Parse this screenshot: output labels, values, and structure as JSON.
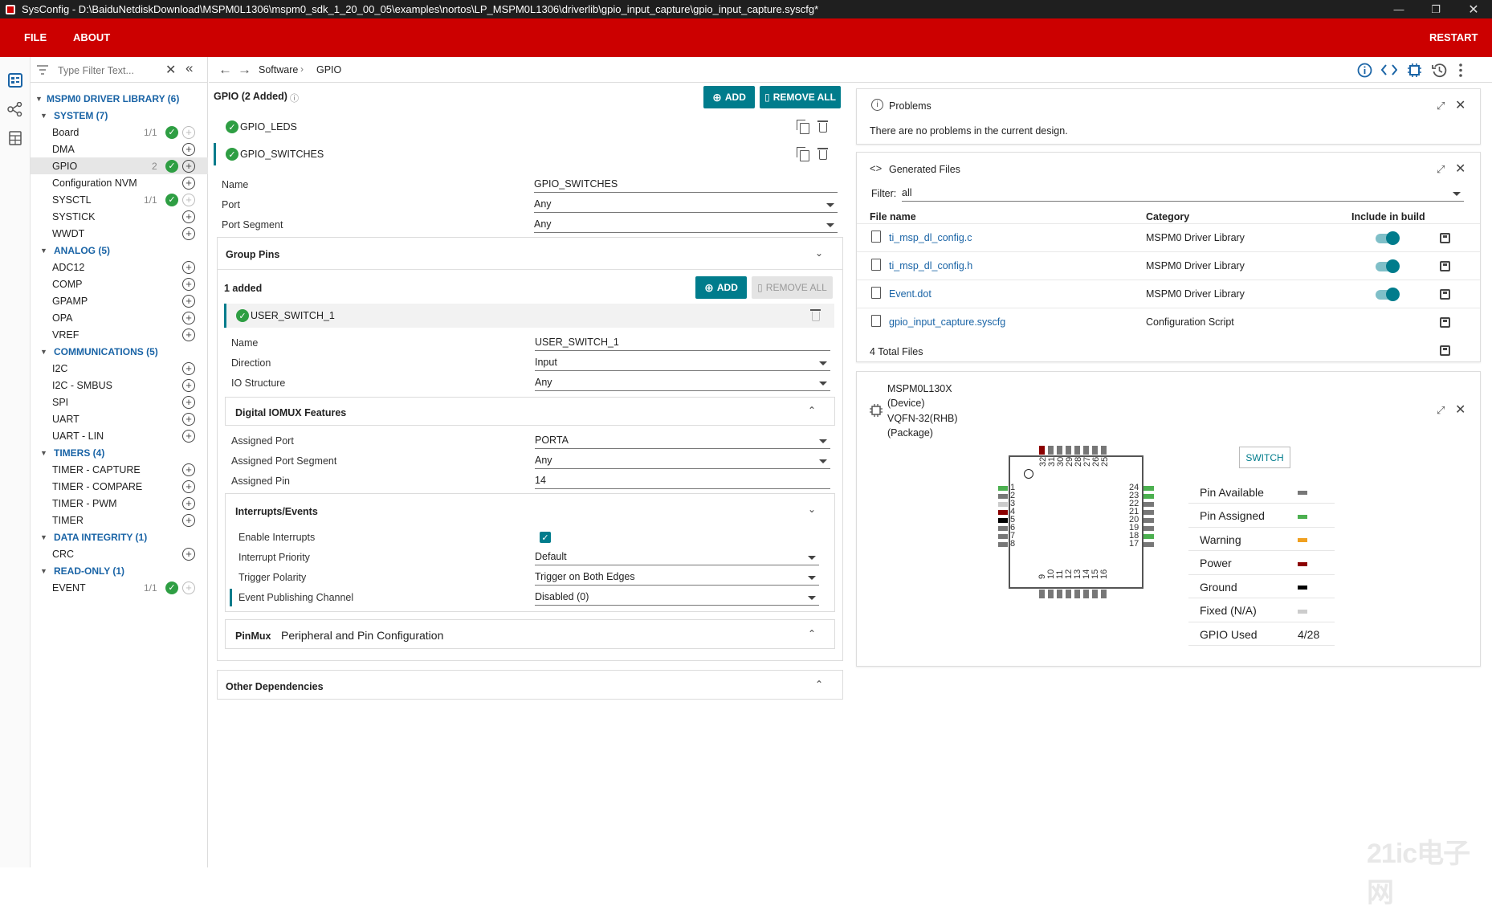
{
  "titlebar": {
    "title": "SysConfig - D:\\BaiduNetdiskDownload\\MSPM0L1306\\mspm0_sdk_1_20_00_05\\examples\\nortos\\LP_MSPM0L1306\\driverlib\\gpio_input_capture\\gpio_input_capture.syscfg*"
  },
  "menu": {
    "file": "FILE",
    "about": "ABOUT",
    "restart": "RESTART"
  },
  "filter": {
    "placeholder": "Type Filter Text..."
  },
  "tree": {
    "root": "MSPM0 DRIVER LIBRARY (6)",
    "system": {
      "label": "SYSTEM (7)",
      "items": [
        "Board",
        "DMA",
        "GPIO",
        "Configuration NVM",
        "SYSCTL",
        "SYSTICK",
        "WWDT"
      ],
      "board_count": "1/1",
      "gpio_count": "2",
      "sysctl_count": "1/1"
    },
    "analog": {
      "label": "ANALOG (5)",
      "items": [
        "ADC12",
        "COMP",
        "GPAMP",
        "OPA",
        "VREF"
      ]
    },
    "comms": {
      "label": "COMMUNICATIONS (5)",
      "items": [
        "I2C",
        "I2C - SMBUS",
        "SPI",
        "UART",
        "UART - LIN"
      ]
    },
    "timers": {
      "label": "TIMERS (4)",
      "items": [
        "TIMER - CAPTURE",
        "TIMER - COMPARE",
        "TIMER - PWM",
        "TIMER"
      ]
    },
    "integrity": {
      "label": "DATA INTEGRITY (1)",
      "items": [
        "CRC"
      ]
    },
    "readonly": {
      "label": "READ-ONLY (1)",
      "items": [
        "EVENT"
      ],
      "event_count": "1/1"
    }
  },
  "breadcrumb": {
    "software": "Software",
    "gpio": "GPIO"
  },
  "config": {
    "header": "GPIO (2 Added)",
    "add": "ADD",
    "remove_all": "REMOVE ALL",
    "instances": [
      "GPIO_LEDS",
      "GPIO_SWITCHES"
    ],
    "name_label": "Name",
    "name_value": "GPIO_SWITCHES",
    "port_label": "Port",
    "port_value": "Any",
    "portseg_label": "Port Segment",
    "portseg_value": "Any",
    "group_pins": "Group Pins",
    "added": "1 added",
    "pin": "USER_SWITCH_1",
    "pin_name_label": "Name",
    "pin_name_value": "USER_SWITCH_1",
    "direction_label": "Direction",
    "direction_value": "Input",
    "io_label": "IO Structure",
    "io_value": "Any",
    "iomux": "Digital IOMUX Features",
    "aport_label": "Assigned Port",
    "aport_value": "PORTA",
    "aportseg_label": "Assigned Port Segment",
    "aportseg_value": "Any",
    "apin_label": "Assigned Pin",
    "apin_value": "14",
    "interrupts": "Interrupts/Events",
    "enint_label": "Enable Interrupts",
    "intprio_label": "Interrupt Priority",
    "intprio_value": "Default",
    "trig_label": "Trigger Polarity",
    "trig_value": "Trigger on Both Edges",
    "evpub_label": "Event Publishing Channel",
    "evpub_value": "Disabled (0)",
    "pinmux_tag": "PinMux",
    "pinmux_title": "Peripheral and Pin Configuration",
    "other_deps": "Other Dependencies"
  },
  "problems": {
    "title": "Problems",
    "text": "There are no problems in the current design."
  },
  "generated": {
    "title": "Generated Files",
    "filter_label": "Filter:",
    "filter_value": "all",
    "col_file": "File name",
    "col_cat": "Category",
    "col_inc": "Include in build",
    "files": [
      {
        "name": "ti_msp_dl_config.c",
        "cat": "MSPM0 Driver Library"
      },
      {
        "name": "ti_msp_dl_config.h",
        "cat": "MSPM0 Driver Library"
      },
      {
        "name": "Event.dot",
        "cat": "MSPM0 Driver Library"
      },
      {
        "name": "gpio_input_capture.syscfg",
        "cat": "Configuration Script"
      }
    ],
    "total": "4 Total Files"
  },
  "device": {
    "line1": "MSPM0L130X",
    "line2": "(Device)",
    "line3": "VQFN-32(RHB)",
    "line4": "(Package)",
    "switch": "SWITCH",
    "top_pins": [
      "32",
      "31",
      "30",
      "29",
      "28",
      "27",
      "26",
      "25"
    ],
    "left_pins": [
      "1",
      "2",
      "3",
      "4",
      "5",
      "6",
      "7",
      "8"
    ],
    "right_pins": [
      "24",
      "23",
      "22",
      "21",
      "20",
      "19",
      "18",
      "17"
    ],
    "bottom_pins": [
      "9",
      "10",
      "11",
      "12",
      "13",
      "14",
      "15",
      "16"
    ]
  },
  "legend": [
    {
      "label": "Pin Available",
      "color": "#777777"
    },
    {
      "label": "Pin Assigned",
      "color": "#4cb050"
    },
    {
      "label": "Warning",
      "color": "#f0a020"
    },
    {
      "label": "Power",
      "color": "#8b0000"
    },
    {
      "label": "Ground",
      "color": "#000000"
    },
    {
      "label": "Fixed (N/A)",
      "color": "#cccccc"
    },
    {
      "label": "GPIO Used",
      "value": "4/28"
    }
  ],
  "watermark": "21ic电子网"
}
